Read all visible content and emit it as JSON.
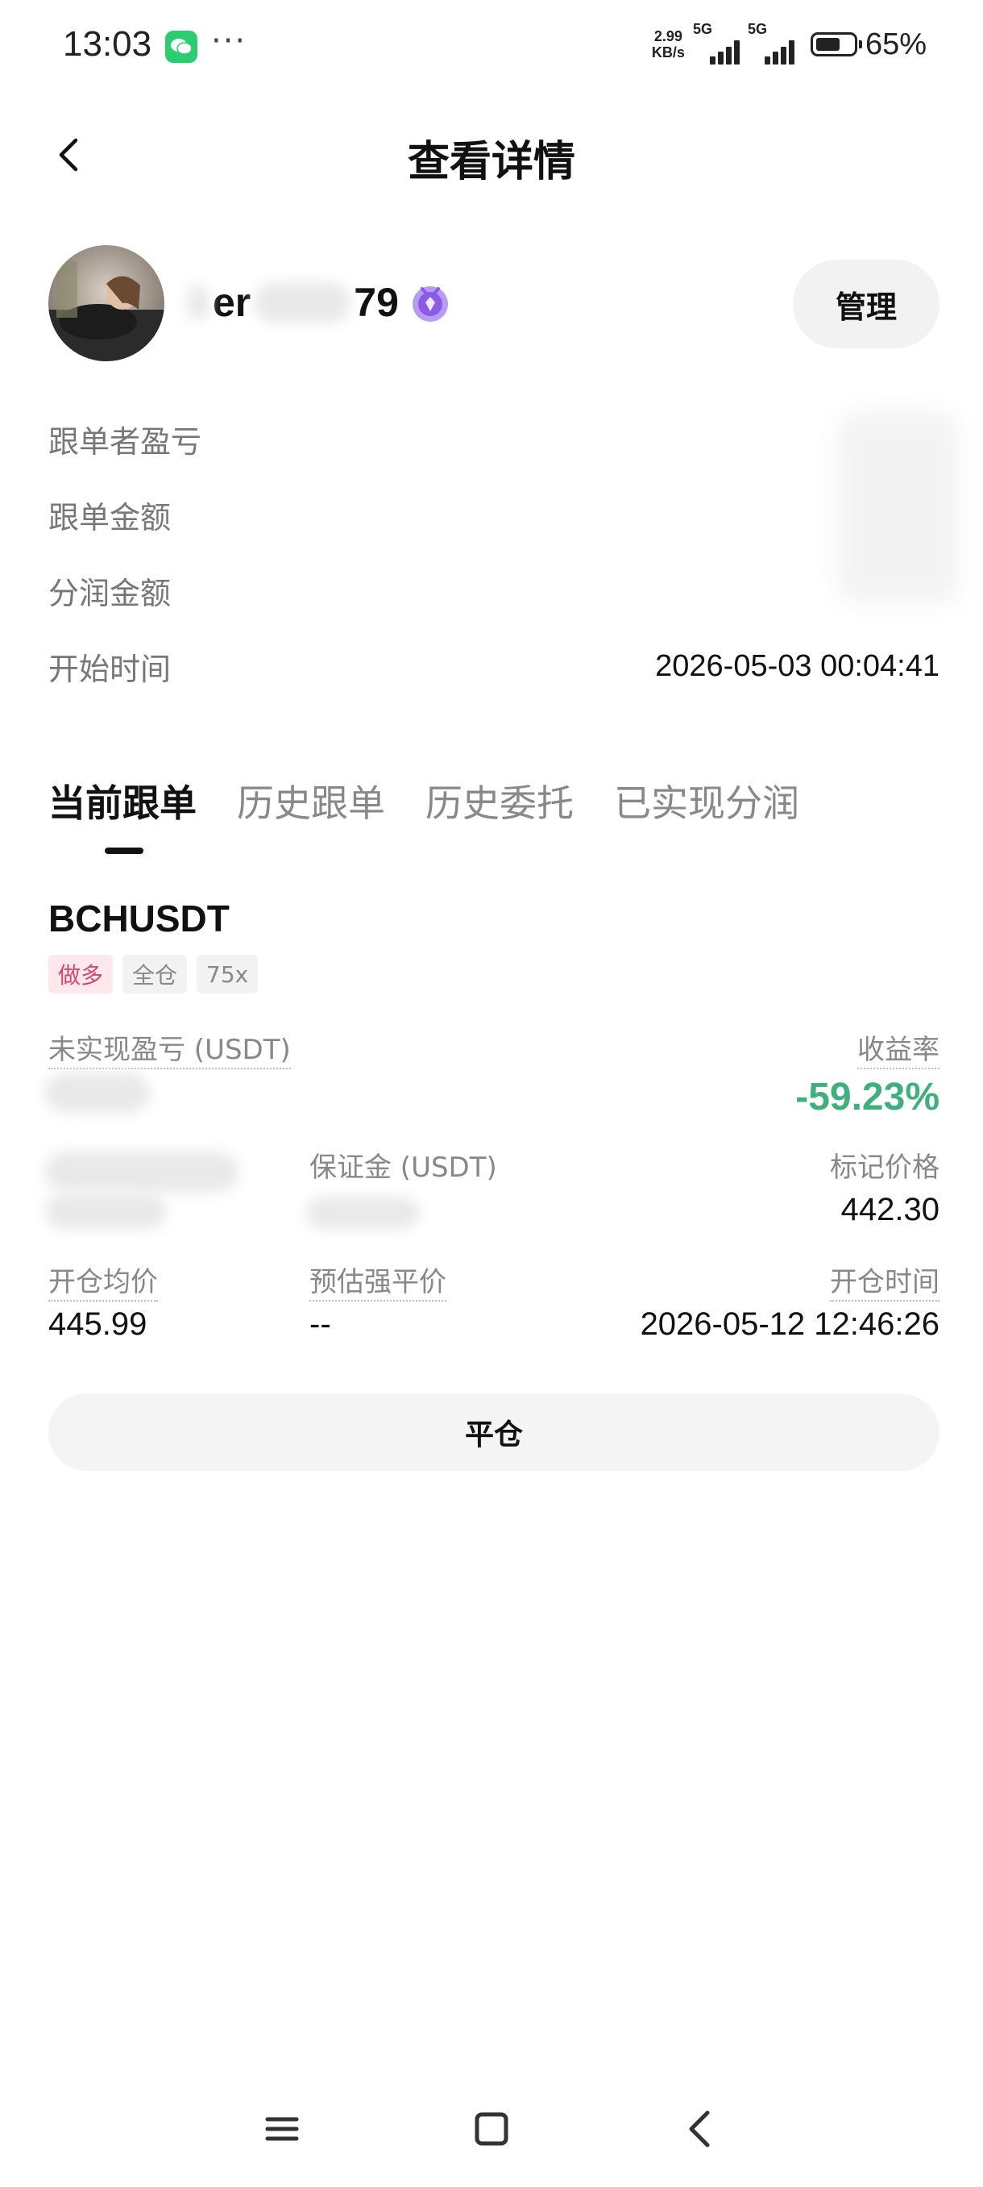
{
  "status_bar": {
    "time": "13:03",
    "more": "···",
    "net_speed_value": "2.99",
    "net_speed_unit": "KB/s",
    "signal1_label": "5G",
    "signal2_label": "5G",
    "battery_percent": "65%",
    "battery_level": 0.65
  },
  "header": {
    "title": "查看详情"
  },
  "profile": {
    "username_part1": "er",
    "username_part2": "79",
    "manage_label": "管理"
  },
  "info": {
    "rows": [
      {
        "label": "跟单者盈亏",
        "value": ""
      },
      {
        "label": "跟单金额",
        "value": ""
      },
      {
        "label": "分润金额",
        "value": ""
      },
      {
        "label": "开始时间",
        "value": "2026-05-03 00:04:41"
      }
    ]
  },
  "tabs": [
    {
      "label": "当前跟单",
      "active": true
    },
    {
      "label": "历史跟单",
      "active": false
    },
    {
      "label": "历史委托",
      "active": false
    },
    {
      "label": "已实现分润",
      "active": false
    }
  ],
  "position": {
    "symbol": "BCHUSDT",
    "tags": [
      "做多",
      "全仓",
      "75x"
    ],
    "unrealized_pnl_label": "未实现盈亏 (USDT)",
    "roi_label": "收益率",
    "roi_value": "-59.23%",
    "margin_label": "保证金 (USDT)",
    "mark_price_label": "标记价格",
    "mark_price_value": "442.30",
    "avg_open_label": "开仓均价",
    "avg_open_value": "445.99",
    "liq_price_label": "预估强平价",
    "liq_price_value": "--",
    "open_time_label": "开仓时间",
    "open_time_value": "2026-05-12 12:46:26",
    "close_label": "平仓"
  },
  "colors": {
    "roi_negative_green": "#3fb07c",
    "long_tag_text": "#d04a6e",
    "long_tag_bg": "#fde8ee"
  }
}
